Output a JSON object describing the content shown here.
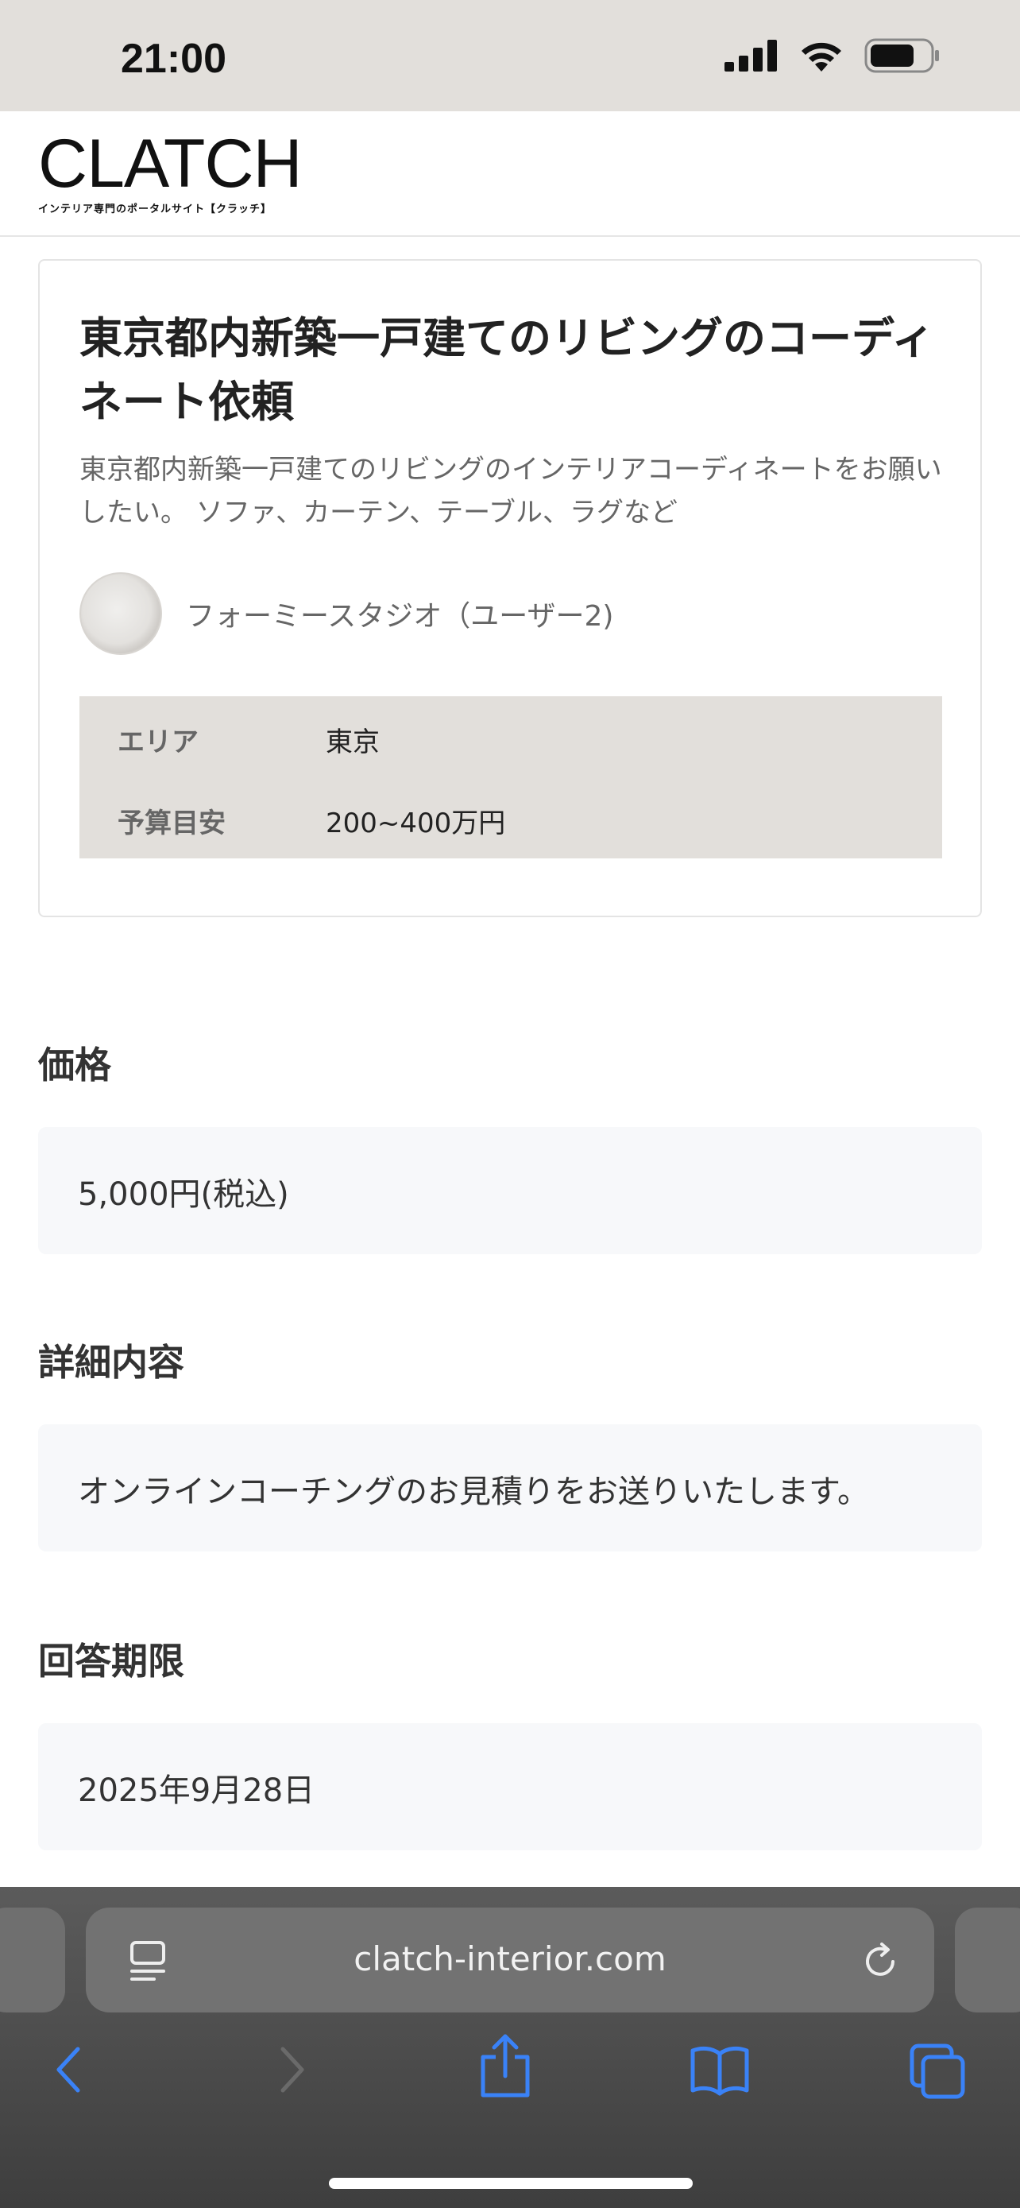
{
  "status_bar": {
    "time": "21:00"
  },
  "header": {
    "logo": "CLATCH",
    "logo_tagline": "インテリア専門のポータルサイト【クラッチ】"
  },
  "request": {
    "title": "東京都内新築一戸建てのリビングのコーディネート依頼",
    "description": "東京都内新築一戸建てのリビングのインテリアコーディネートをお願いしたい。 ソファ、カーテン、テーブル、ラグなど",
    "author": "フォーミースタジオ（ユーザー2)",
    "info": [
      {
        "label": "エリア",
        "value": "東京"
      },
      {
        "label": "予算目安",
        "value": "200~400万円"
      }
    ]
  },
  "sections": {
    "price": {
      "heading": "価格",
      "value": "5,000円(税込)"
    },
    "details": {
      "heading": "詳細内容",
      "value": "オンラインコーチングのお見積りをお送りいたします。"
    },
    "deadline": {
      "heading": "回答期限",
      "value": "2025年9月28日"
    }
  },
  "browser": {
    "url": "clatch-interior.com",
    "accent_color": "#3a82f7"
  }
}
